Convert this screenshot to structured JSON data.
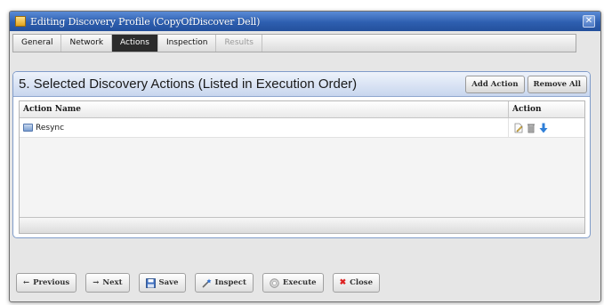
{
  "window": {
    "title": "Editing Discovery Profile (CopyOfDiscover Dell)"
  },
  "tabs": [
    {
      "label": "General"
    },
    {
      "label": "Network"
    },
    {
      "label": "Actions"
    },
    {
      "label": "Inspection"
    },
    {
      "label": "Results"
    }
  ],
  "panel": {
    "title": "5. Selected Discovery Actions (Listed in Execution Order)",
    "add_label": "Add Action",
    "remove_label": "Remove All"
  },
  "grid": {
    "columns": [
      "Action Name",
      "Action"
    ],
    "rows": [
      {
        "name": "Resync"
      }
    ]
  },
  "footer": {
    "previous": "Previous",
    "next": "Next",
    "save": "Save",
    "inspect": "Inspect",
    "execute": "Execute",
    "close": "Close"
  },
  "colors": {
    "titlebar": "#2e5fb0",
    "panel_header": "#c8d6ee",
    "active_tab": "#2c2c2c"
  },
  "icons": {
    "edit": "edit-icon",
    "delete": "delete-icon",
    "move_down": "arrow-down-icon"
  }
}
